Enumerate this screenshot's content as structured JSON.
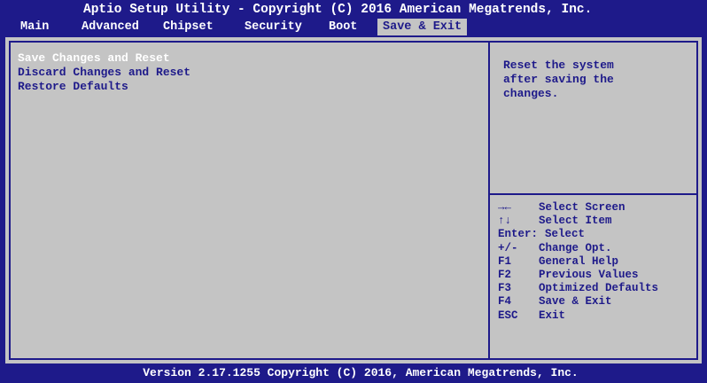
{
  "header": {
    "title": "Aptio Setup Utility - Copyright (C) 2016 American Megatrends, Inc."
  },
  "tabs": [
    {
      "label": "Main"
    },
    {
      "label": "Advanced"
    },
    {
      "label": "Chipset"
    },
    {
      "label": "Security"
    },
    {
      "label": "Boot"
    },
    {
      "label": "Save & Exit",
      "active": true
    }
  ],
  "menu": {
    "items": [
      {
        "label": "Save Changes and Reset",
        "selected": true
      },
      {
        "label": "Discard Changes and Reset"
      },
      {
        "label": "Restore Defaults"
      }
    ]
  },
  "help": {
    "text": "Reset the system\nafter saving the\nchanges."
  },
  "keys": [
    {
      "icon": "left-right-arrows-icon",
      "key": "→←",
      "desc": "Select Screen"
    },
    {
      "icon": "up-down-arrows-icon",
      "key": "↑↓",
      "desc": "Select Item"
    },
    {
      "key": "Enter:",
      "desc": "Select",
      "combined": true
    },
    {
      "key": "+/-",
      "desc": "Change Opt."
    },
    {
      "key": "F1",
      "desc": "General Help"
    },
    {
      "key": "F2",
      "desc": "Previous Values"
    },
    {
      "key": "F3",
      "desc": "Optimized Defaults"
    },
    {
      "key": "F4",
      "desc": "Save & Exit"
    },
    {
      "key": "ESC",
      "desc": "Exit"
    }
  ],
  "footer": {
    "text": "Version 2.17.1255 Copyright (C) 2016, American Megatrends, Inc."
  },
  "colors": {
    "background": "#1e1a8a",
    "panel": "#c4c4c4",
    "text_dark": "#1e1a8a",
    "text_light": "#ffffff"
  }
}
